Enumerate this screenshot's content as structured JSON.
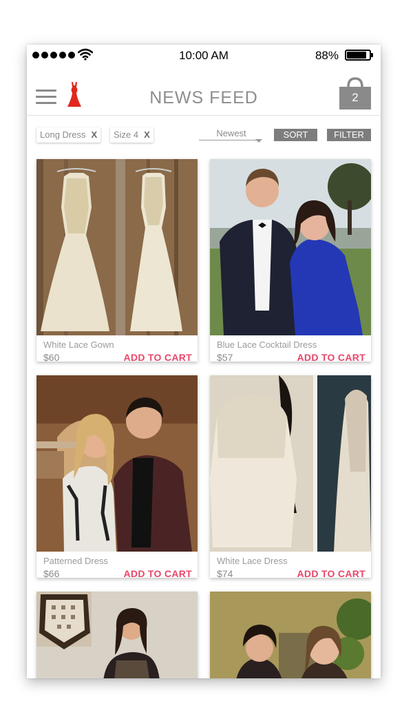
{
  "status_bar": {
    "time": "10:00 AM",
    "battery": "88%",
    "battery_level": 0.88
  },
  "header": {
    "title": "NEWS FEED",
    "cart_count": "2"
  },
  "filters": {
    "chips": [
      {
        "label": "Long Dress",
        "remove": "X"
      },
      {
        "label": "Size 4",
        "remove": "X"
      }
    ],
    "sort_selected": "Newest",
    "sort_button": "SORT",
    "filter_button": "FILTER"
  },
  "products": [
    {
      "name": "White Lace Gown",
      "price": "$60",
      "action": "ADD TO CART"
    },
    {
      "name": "Blue Lace Cocktail Dress",
      "price": "$57",
      "action": "ADD TO CART"
    },
    {
      "name": "Patterned Dress",
      "price": "$66",
      "action": "ADD TO CART"
    },
    {
      "name": "White Lace Dress",
      "price": "$74",
      "action": "ADD TO CART"
    }
  ],
  "colors": {
    "accent": "#e8466a",
    "logo": "#e0281e",
    "button": "#7d7d7d",
    "title": "#8d8d8d"
  }
}
